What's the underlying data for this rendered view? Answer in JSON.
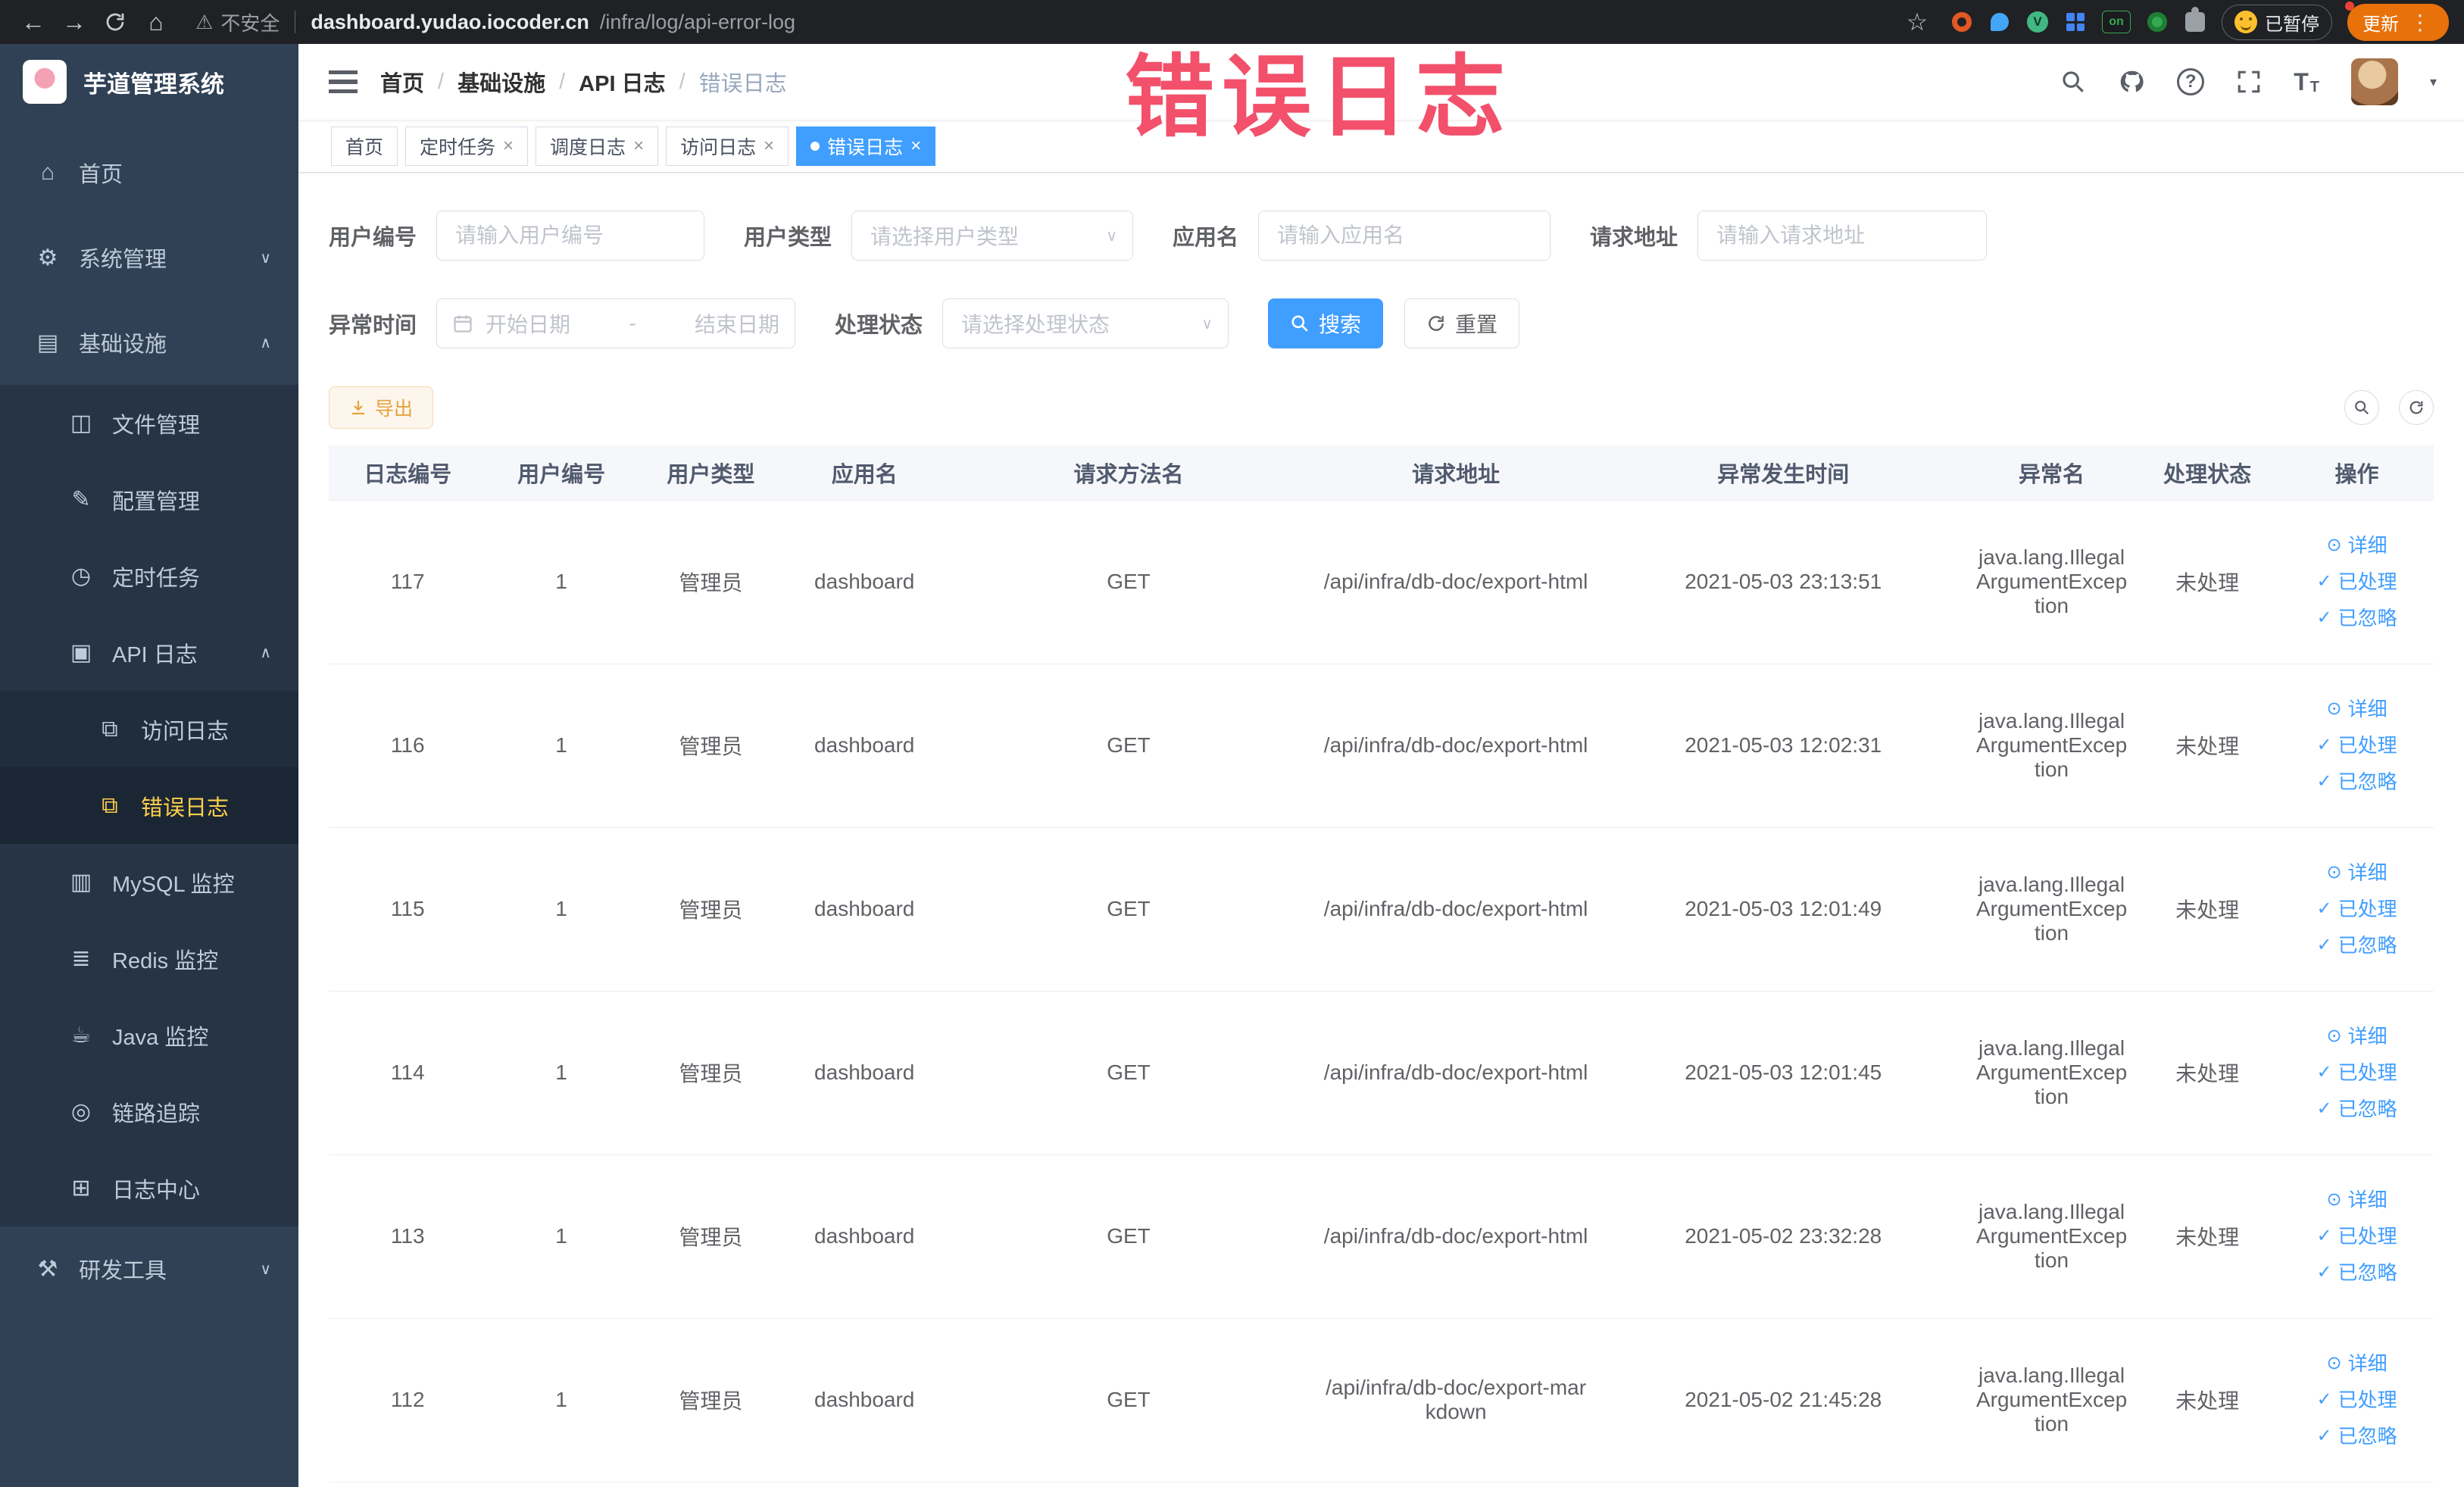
{
  "browser": {
    "security_label": "不安全",
    "url_host": "dashboard.yudao.iocoder.cn",
    "url_path": "/infra/log/api-error-log",
    "ext_on_label": "on",
    "paused_label": "已暂停",
    "update_label": "更新"
  },
  "glyphs": {
    "back": "←",
    "forward": "→",
    "home": "⌂",
    "warning": "⚠",
    "star": "☆",
    "menu_dots": "⋮",
    "question": "?",
    "caret_down": "▾",
    "select_arrow": "∨",
    "vue_letter": "V",
    "text_icon": "T"
  },
  "annotation": {
    "text": "错误日志"
  },
  "sidebar": {
    "title": "芋道管理系统",
    "items": [
      {
        "name": "sidebar-item-home",
        "icon_name": "home-icon",
        "icon": "⌂",
        "label": "首页",
        "level": 1,
        "arrow": "",
        "active": false
      },
      {
        "name": "sidebar-item-system-manage",
        "icon_name": "gear-icon",
        "icon": "⚙",
        "label": "系统管理",
        "level": 1,
        "arrow": "∨",
        "active": false
      },
      {
        "name": "sidebar-item-infrastructure",
        "icon_name": "infrastructure-icon",
        "icon": "▤",
        "label": "基础设施",
        "level": 1,
        "arrow": "∧",
        "active": false
      },
      {
        "name": "sidebar-item-file-manage",
        "icon_name": "file-icon",
        "icon": "◫",
        "label": "文件管理",
        "level": 2,
        "arrow": "",
        "active": false
      },
      {
        "name": "sidebar-item-config-manage",
        "icon_name": "config-icon",
        "icon": "✎",
        "label": "配置管理",
        "level": 2,
        "arrow": "",
        "active": false
      },
      {
        "name": "sidebar-item-scheduled-jobs",
        "icon_name": "clock-icon",
        "icon": "◷",
        "label": "定时任务",
        "level": 2,
        "arrow": "",
        "active": false
      },
      {
        "name": "sidebar-item-api-logs",
        "icon_name": "api-log-icon",
        "icon": "▣",
        "label": "API 日志",
        "level": 2,
        "arrow": "∧",
        "active": false
      },
      {
        "name": "sidebar-item-access-log",
        "icon_name": "access-log-icon",
        "icon": "⧉",
        "label": "访问日志",
        "level": 3,
        "arrow": "",
        "active": false
      },
      {
        "name": "sidebar-item-error-log",
        "icon_name": "error-log-icon",
        "icon": "⧉",
        "label": "错误日志",
        "level": 3,
        "arrow": "",
        "active": true
      },
      {
        "name": "sidebar-item-mysql-monitor",
        "icon_name": "mysql-icon",
        "icon": "▥",
        "label": "MySQL 监控",
        "level": 2,
        "arrow": "",
        "active": false
      },
      {
        "name": "sidebar-item-redis-monitor",
        "icon_name": "redis-icon",
        "icon": "≣",
        "label": "Redis 监控",
        "level": 2,
        "arrow": "",
        "active": false
      },
      {
        "name": "sidebar-item-java-monitor",
        "icon_name": "java-icon",
        "icon": "☕",
        "label": "Java 监控",
        "level": 2,
        "arrow": "",
        "active": false
      },
      {
        "name": "sidebar-item-trace",
        "icon_name": "trace-icon",
        "icon": "◎",
        "label": "链路追踪",
        "level": 2,
        "arrow": "",
        "active": false
      },
      {
        "name": "sidebar-item-log-center",
        "icon_name": "log-center-icon",
        "icon": "⊞",
        "label": "日志中心",
        "level": 2,
        "arrow": "",
        "active": false
      },
      {
        "name": "sidebar-item-dev-tools",
        "icon_name": "tools-icon",
        "icon": "⚒",
        "label": "研发工具",
        "level": 1,
        "arrow": "∨",
        "active": false
      }
    ]
  },
  "breadcrumb": {
    "separator": "/",
    "items": [
      "首页",
      "基础设施",
      "API 日志",
      "错误日志"
    ]
  },
  "tabs": {
    "close_char": "×",
    "items": [
      {
        "name": "tab-home",
        "label": "首页",
        "closable": false,
        "active": false
      },
      {
        "name": "tab-scheduled-jobs",
        "label": "定时任务",
        "closable": true,
        "active": false
      },
      {
        "name": "tab-schedule-log",
        "label": "调度日志",
        "closable": true,
        "active": false
      },
      {
        "name": "tab-access-log",
        "label": "访问日志",
        "closable": true,
        "active": false
      },
      {
        "name": "tab-error-log",
        "label": "错误日志",
        "closable": true,
        "active": true
      }
    ]
  },
  "filters": {
    "user_id": {
      "label": "用户编号",
      "placeholder": "请输入用户编号"
    },
    "user_type": {
      "label": "用户类型",
      "placeholder": "请选择用户类型"
    },
    "app_name": {
      "label": "应用名",
      "placeholder": "请输入应用名"
    },
    "request_url": {
      "label": "请求地址",
      "placeholder": "请输入请求地址"
    },
    "exception_time": {
      "label": "异常时间",
      "start_placeholder": "开始日期",
      "separator": "-",
      "end_placeholder": "结束日期"
    },
    "process_status": {
      "label": "处理状态",
      "placeholder": "请选择处理状态"
    },
    "search_label": "搜索",
    "reset_label": "重置"
  },
  "toolbar": {
    "export_label": "导出"
  },
  "table": {
    "columns": [
      "日志编号",
      "用户编号",
      "用户类型",
      "应用名",
      "请求方法名",
      "请求地址",
      "异常发生时间",
      "异常名",
      "处理状态",
      "操作"
    ],
    "row_actions": [
      {
        "icon": "⊙",
        "label": "详细"
      },
      {
        "icon": "✓",
        "label": "已处理"
      },
      {
        "icon": "✓",
        "label": "已忽略"
      }
    ],
    "rows": [
      {
        "id": "117",
        "user_id": "1",
        "user_type": "管理员",
        "app": "dashboard",
        "method": "GET",
        "url": "/api/infra/db-doc/export-html",
        "time": "2021-05-03 23:13:51",
        "exception": "java.lang.IllegalArgumentException",
        "status": "未处理"
      },
      {
        "id": "116",
        "user_id": "1",
        "user_type": "管理员",
        "app": "dashboard",
        "method": "GET",
        "url": "/api/infra/db-doc/export-html",
        "time": "2021-05-03 12:02:31",
        "exception": "java.lang.IllegalArgumentException",
        "status": "未处理"
      },
      {
        "id": "115",
        "user_id": "1",
        "user_type": "管理员",
        "app": "dashboard",
        "method": "GET",
        "url": "/api/infra/db-doc/export-html",
        "time": "2021-05-03 12:01:49",
        "exception": "java.lang.IllegalArgumentException",
        "status": "未处理"
      },
      {
        "id": "114",
        "user_id": "1",
        "user_type": "管理员",
        "app": "dashboard",
        "method": "GET",
        "url": "/api/infra/db-doc/export-html",
        "time": "2021-05-03 12:01:45",
        "exception": "java.lang.IllegalArgumentException",
        "status": "未处理"
      },
      {
        "id": "113",
        "user_id": "1",
        "user_type": "管理员",
        "app": "dashboard",
        "method": "GET",
        "url": "/api/infra/db-doc/export-html",
        "time": "2021-05-02 23:32:28",
        "exception": "java.lang.IllegalArgumentException",
        "status": "未处理"
      },
      {
        "id": "112",
        "user_id": "1",
        "user_type": "管理员",
        "app": "dashboard",
        "method": "GET",
        "url": "/api/infra/db-doc/export-markdown",
        "time": "2021-05-02 21:45:28",
        "exception": "java.lang.IllegalArgumentException",
        "status": "未处理"
      }
    ]
  }
}
